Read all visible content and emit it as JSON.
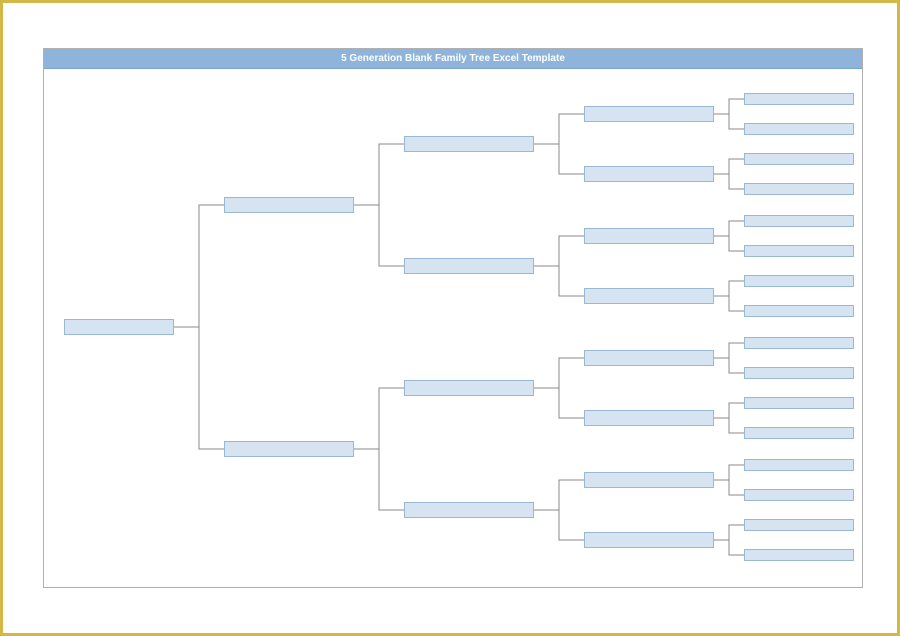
{
  "title": "5 Generation Blank Family Tree Excel Template",
  "colors": {
    "frameBorder": "#d4b845",
    "titleBg": "#8eb4db",
    "boxFill": "#d6e3f0",
    "boxBorder": "#9bb8d3"
  },
  "generations": {
    "gen1": {
      "count": 1,
      "label": ""
    },
    "gen2": {
      "count": 2,
      "label": ""
    },
    "gen3": {
      "count": 4,
      "label": ""
    },
    "gen4": {
      "count": 8,
      "label": ""
    },
    "gen5": {
      "count": 16,
      "label": ""
    }
  }
}
